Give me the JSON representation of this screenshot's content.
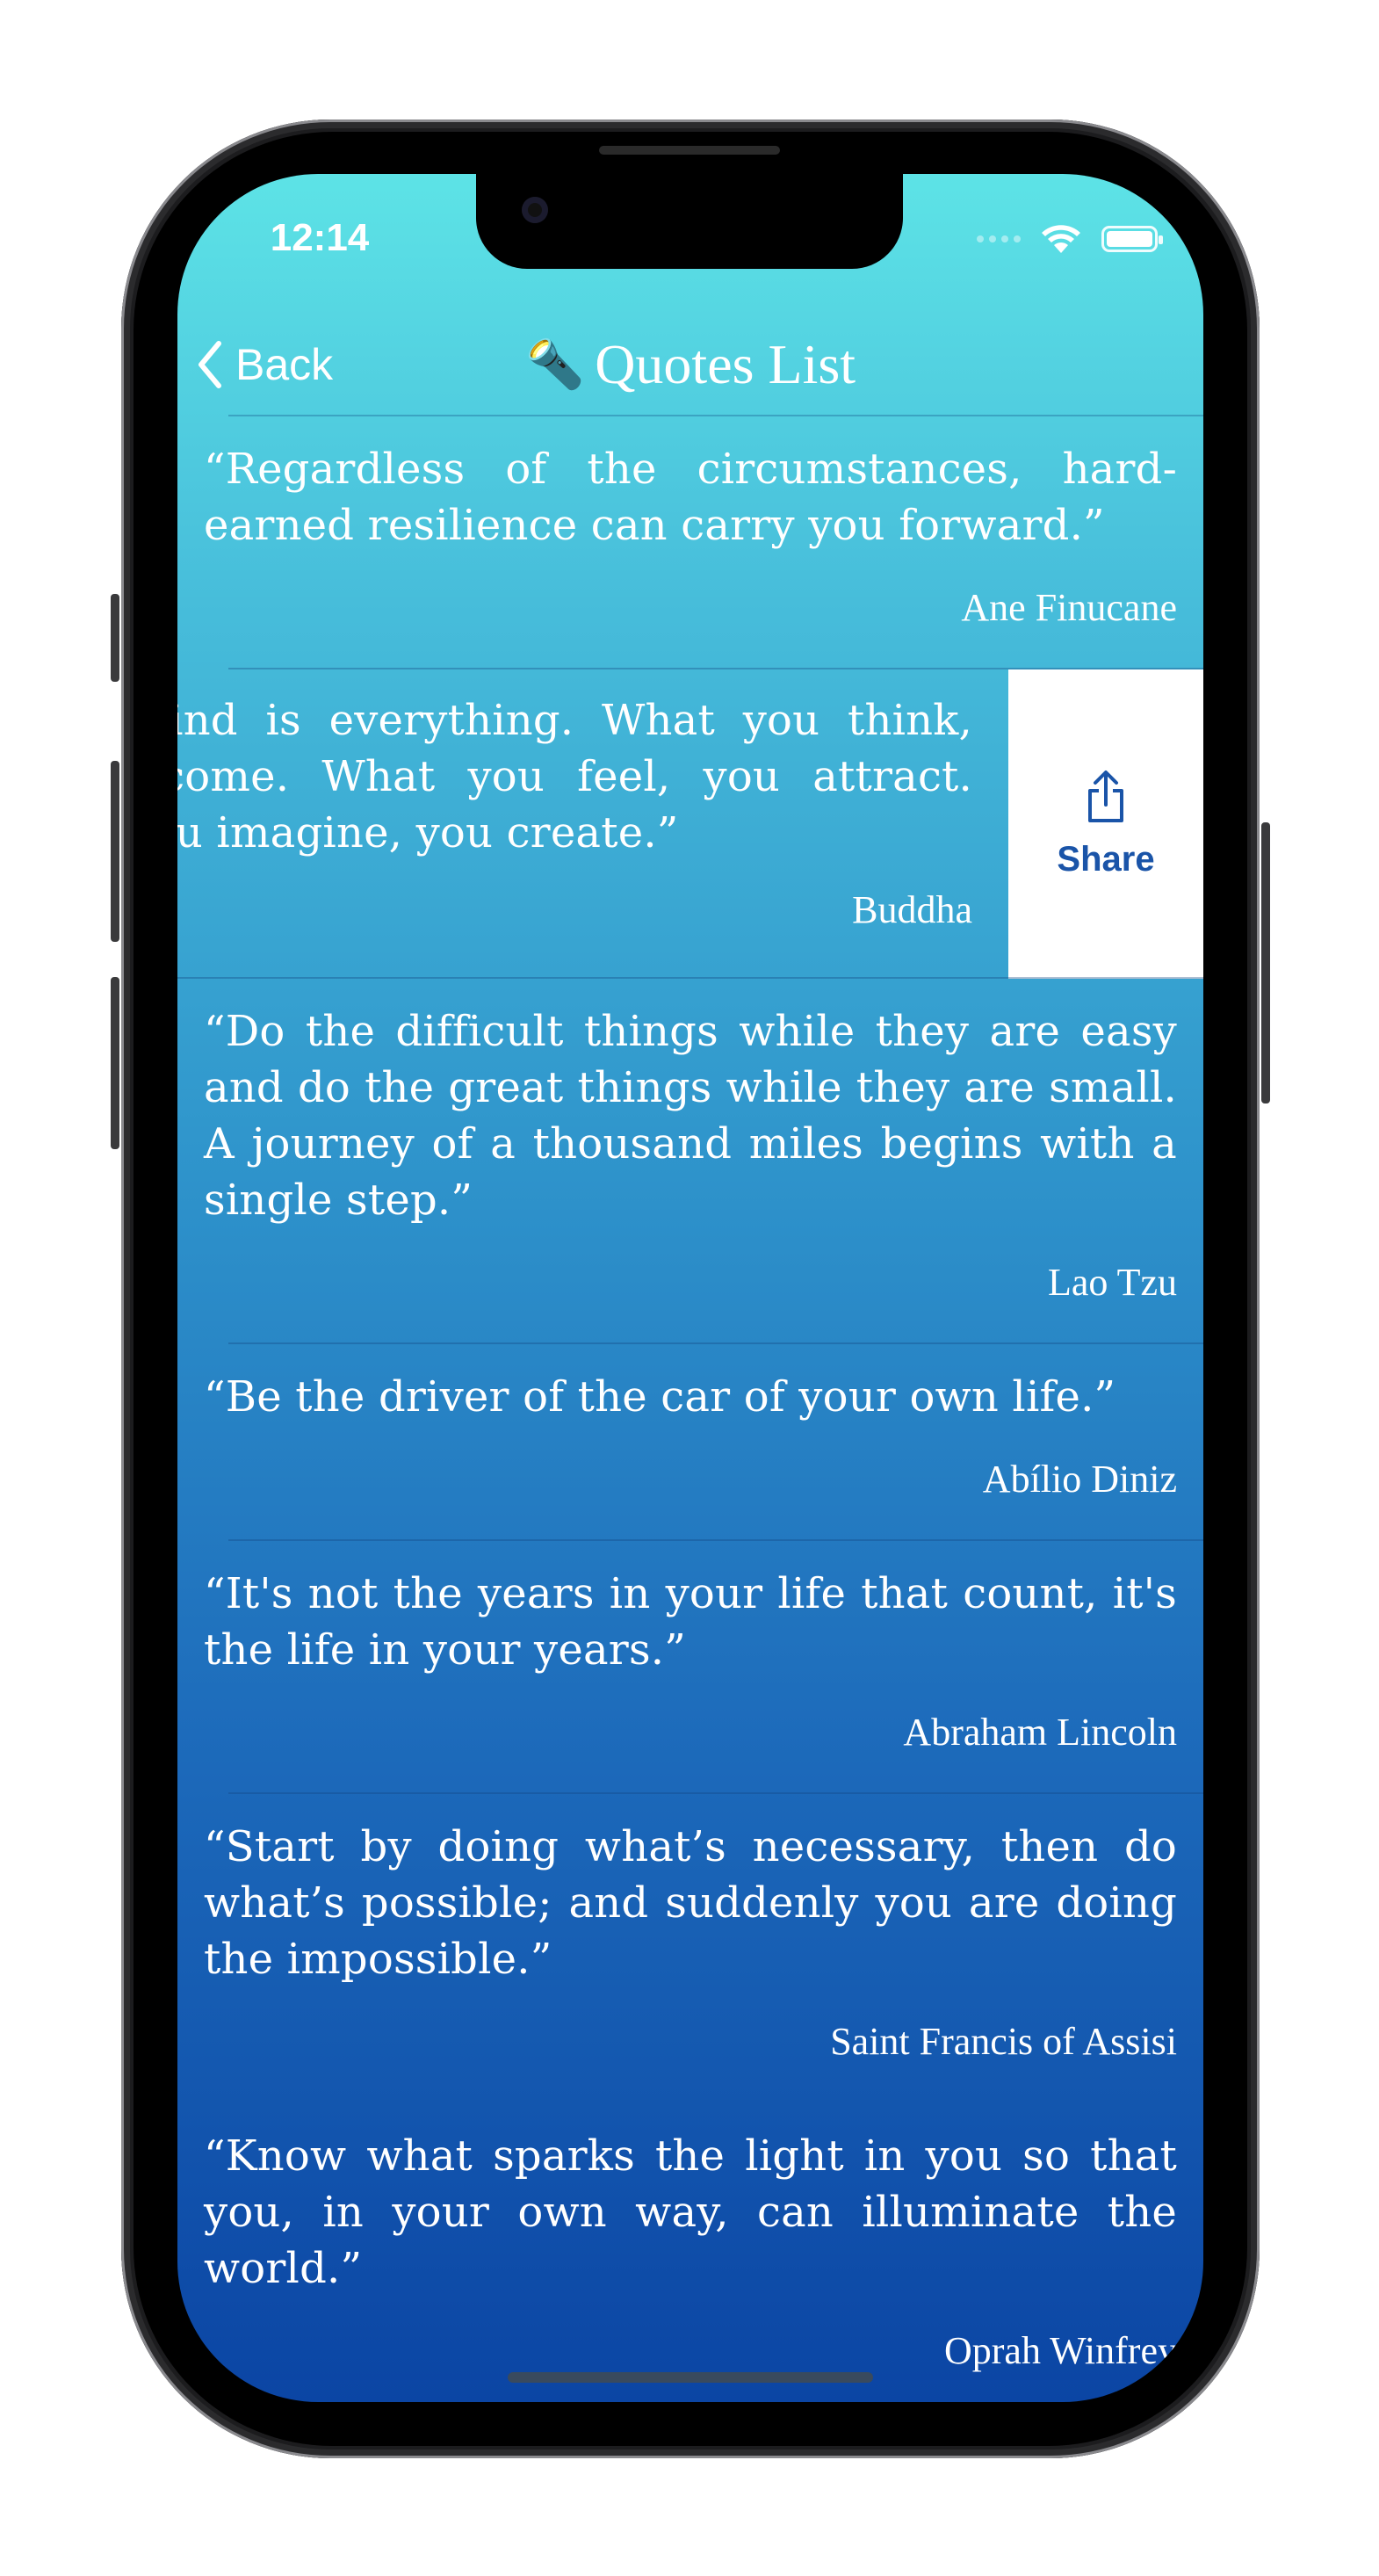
{
  "status_bar": {
    "time": "12:14"
  },
  "nav": {
    "back_label": "Back",
    "title_emoji": "🔦",
    "title": "Quotes List"
  },
  "quotes": [
    {
      "text": "“Regardless of the circumstances, hard-earned resilience can carry you forward.”",
      "author": "Ane Finucane"
    },
    {
      "text": "“The mind is everything. What you think, you become. What you feel, you attract. What you imagine, you create.”",
      "author": "Buddha"
    },
    {
      "text": "“Do the difficult things while they are easy and do the great things while they are small. A journey of a thousand miles begins with a single step.”",
      "author": "Lao Tzu"
    },
    {
      "text": "“Be the driver of the car of your own life.”",
      "author": "Abílio Diniz"
    },
    {
      "text": "“It's not the years in your life that count, it's the life in your years.”",
      "author": "Abraham Lincoln"
    },
    {
      "text": "“Start by doing what’s necessary, then do what’s possible; and suddenly you are doing the impossible.”",
      "author": "Saint Francis of Assisi"
    },
    {
      "text": "“Know what sparks the light in you so that you, in your own way, can illuminate the world.”",
      "author": "Oprah Winfrey"
    }
  ],
  "swipe_action": {
    "label": "Share",
    "icon": "share-icon",
    "color": "#1a54a8"
  }
}
